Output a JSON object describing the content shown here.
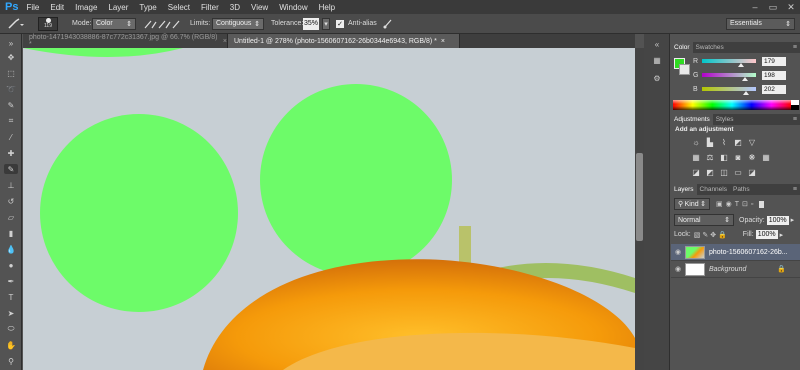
{
  "app": {
    "logo": "Ps"
  },
  "menu": [
    "File",
    "Edit",
    "Image",
    "Layer",
    "Type",
    "Select",
    "Filter",
    "3D",
    "View",
    "Window",
    "Help"
  ],
  "options": {
    "brush_size": "119",
    "mode_label": "Mode:",
    "mode_value": "Color",
    "limits_label": "Limits:",
    "limits_value": "Contiguous",
    "tolerance_label": "Tolerance:",
    "tolerance_value": "35%",
    "antialias_label": "Anti-alias",
    "antialias_checked": true,
    "workspace": "Essentials"
  },
  "tabs": [
    {
      "label": "photo-1471943038886-87c772c31367.jpg @ 66.7% (RGB/8) *",
      "close": "×",
      "active": false
    },
    {
      "label": "Untitled-1 @ 278% (photo-1560607162-26b0344e6943, RGB/8) *",
      "close": "×",
      "active": true
    }
  ],
  "canvas": {
    "bg": "#c9d1d6",
    "paint_color": "#6dfb69"
  },
  "color_panel": {
    "tabs": [
      "Color",
      "Swatches"
    ],
    "fg_color": "#2fdc22",
    "channels": [
      {
        "label": "R",
        "value": "179"
      },
      {
        "label": "G",
        "value": "198"
      },
      {
        "label": "B",
        "value": "202"
      }
    ]
  },
  "adjustments_panel": {
    "tabs": [
      "Adjustments",
      "Styles"
    ],
    "heading": "Add an adjustment"
  },
  "layers_panel": {
    "tabs": [
      "Layers",
      "Channels",
      "Paths"
    ],
    "kind_label": "Kind",
    "blend_mode": "Normal",
    "opacity_label": "Opacity:",
    "opacity_value": "100%",
    "lock_label": "Lock:",
    "fill_label": "Fill:",
    "fill_value": "100%",
    "layers": [
      {
        "name": "photo-1560607162-26b...",
        "visible": true,
        "selected": true
      },
      {
        "name": "Background",
        "visible": true,
        "selected": false,
        "locked": true
      }
    ]
  }
}
